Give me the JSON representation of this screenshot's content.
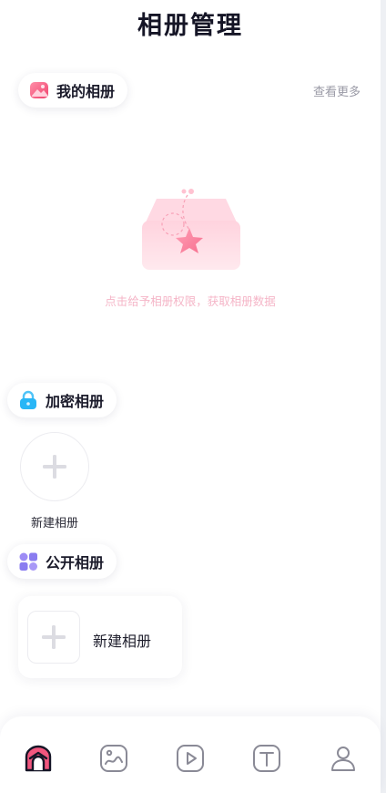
{
  "header": {
    "title": "相册管理"
  },
  "my_album": {
    "label": "我的相册",
    "see_more": "查看更多",
    "empty_tip": "点击给予相册权限，获取相册数据"
  },
  "encrypted_album": {
    "label": "加密相册",
    "new_album_label": "新建相册"
  },
  "public_album": {
    "label": "公开相册",
    "new_album_label": "新建相册"
  },
  "tabbar": {
    "tabs": [
      {
        "icon": "home-icon",
        "active": true
      },
      {
        "icon": "photo-icon",
        "active": false
      },
      {
        "icon": "video-play-icon",
        "active": false
      },
      {
        "icon": "text-icon",
        "active": false
      },
      {
        "icon": "profile-icon",
        "active": false
      }
    ]
  },
  "colors": {
    "accent_pink": "#f2567e",
    "icon_gray": "#8a8a96",
    "tip_pink": "#f5b5c7",
    "lock_blue": "#29b6f6",
    "grid_purple": "#8a7cf0"
  }
}
